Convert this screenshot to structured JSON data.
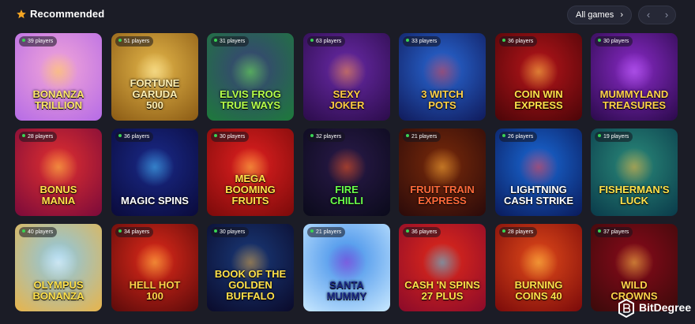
{
  "header": {
    "title": "Recommended",
    "all_games_label": "All games",
    "all_games_chevron": "›",
    "prev_label": "‹",
    "next_label": "›",
    "star_color": "#f5a623"
  },
  "games": [
    {
      "players": "39 players",
      "name": "BONANZA\nTRILLION",
      "colors": [
        "#f3a6d8",
        "#b56be6"
      ],
      "accent": "#ffcf4a",
      "text": "#ffe76a"
    },
    {
      "players": "51 players",
      "name": "FORTUNE GARUDA\n500",
      "colors": [
        "#e6b84a",
        "#8a5a14"
      ],
      "accent": "#fff1b0",
      "text": "#fff0b3"
    },
    {
      "players": "31 players",
      "name": "ELVIS FROG\nTRUE WAYS",
      "colors": [
        "#3a3f7a",
        "#1d7a3a"
      ],
      "accent": "#6dff4a",
      "text": "#b6ff4a"
    },
    {
      "players": "63 players",
      "name": "SEXY\nJOKER",
      "colors": [
        "#6a2aa8",
        "#2b0c4a"
      ],
      "accent": "#ff9a3a",
      "text": "#ffcc44"
    },
    {
      "players": "33 players",
      "name": "3 WITCH\nPOTS",
      "colors": [
        "#2a6ad8",
        "#101a5a"
      ],
      "accent": "#e23a3a",
      "text": "#ffd24a"
    },
    {
      "players": "36 players",
      "name": "COIN WIN\nEXPRESS",
      "colors": [
        "#b8151a",
        "#4a0508"
      ],
      "accent": "#ffd24a",
      "text": "#ffe14a"
    },
    {
      "players": "30 players",
      "name": "MUMMYLAND\nTREASURES",
      "colors": [
        "#8a2ac8",
        "#2a0a4a"
      ],
      "accent": "#c46aff",
      "text": "#ffd24a"
    },
    {
      "players": "28 players",
      "name": "BONUS\nMANIA",
      "colors": [
        "#e23030",
        "#7a0a3a"
      ],
      "accent": "#ffd24a",
      "text": "#ffe14a"
    },
    {
      "players": "36 players",
      "name": "MAGIC SPINS",
      "colors": [
        "#1a2a8a",
        "#0a0a3a"
      ],
      "accent": "#4ac8ff",
      "text": "#ffffff"
    },
    {
      "players": "30 players",
      "name": "MEGA BOOMING\nFRUITS",
      "colors": [
        "#e22020",
        "#7a0a0a"
      ],
      "accent": "#ffd24a",
      "text": "#ffe14a"
    },
    {
      "players": "32 players",
      "name": "FIRE\nCHILLI",
      "colors": [
        "#2a1a4a",
        "#0a0a1a"
      ],
      "accent": "#ff5a1a",
      "text": "#6aff4a"
    },
    {
      "players": "21 players",
      "name": "FRUIT TRAIN\nEXPRESS",
      "colors": [
        "#7a2a0a",
        "#2a0a0a"
      ],
      "accent": "#ffb43a",
      "text": "#ff6a3a"
    },
    {
      "players": "26 players",
      "name": "LIGHTNING\nCASH STRIKE",
      "colors": [
        "#1a6ad8",
        "#0a1a5a"
      ],
      "accent": "#ff3a3a",
      "text": "#ffffff"
    },
    {
      "players": "19 players",
      "name": "FISHERMAN'S\nLUCK",
      "colors": [
        "#2a8a7a",
        "#0a3a4a"
      ],
      "accent": "#ffb43a",
      "text": "#ffe14a"
    },
    {
      "players": "40 players",
      "name": "OLYMPUS\nBONANZA",
      "colors": [
        "#8ac8e8",
        "#e8b44a"
      ],
      "accent": "#ffffff",
      "text": "#ffe14a"
    },
    {
      "players": "34 players",
      "name": "HELL HOT\n100",
      "colors": [
        "#e22a1a",
        "#5a0a0a"
      ],
      "accent": "#ffd24a",
      "text": "#ffd24a"
    },
    {
      "players": "30 players",
      "name": "BOOK OF THE\nGOLDEN BUFFALO",
      "colors": [
        "#1a3a7a",
        "#0a0a2a"
      ],
      "accent": "#e8a83a",
      "text": "#ffe14a"
    },
    {
      "players": "21 players",
      "name": "SANTA\nMUMMY",
      "colors": [
        "#3a8ae8",
        "#c8e8ff"
      ],
      "accent": "#a83ad8",
      "text": "#1a2a8a"
    },
    {
      "players": "36 players",
      "name": "CASH 'N SPINS\n27 PLUS",
      "colors": [
        "#e22a1a",
        "#8a0a2a"
      ],
      "accent": "#3ad8ff",
      "text": "#ffe14a"
    },
    {
      "players": "28 players",
      "name": "BURNING\nCOINS 40",
      "colors": [
        "#e24a1a",
        "#7a0a0a"
      ],
      "accent": "#ffd24a",
      "text": "#ffe14a"
    },
    {
      "players": "37 players",
      "name": "WILD\nCROWNS",
      "colors": [
        "#8a0a1a",
        "#3a0a0a"
      ],
      "accent": "#ffd24a",
      "text": "#ffd24a"
    }
  ],
  "watermark": {
    "text": "BitDegree"
  }
}
